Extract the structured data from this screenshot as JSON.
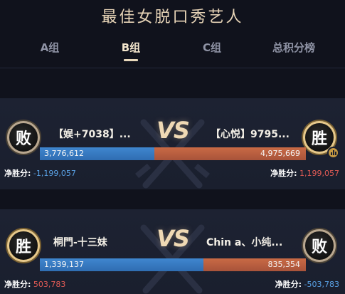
{
  "title": "最佳女脱口秀艺人",
  "tabs": [
    {
      "label": "A组",
      "active": false
    },
    {
      "label": "B组",
      "active": true
    },
    {
      "label": "C组",
      "active": false
    },
    {
      "label": "总积分榜",
      "active": false
    }
  ],
  "vs_label": "VS",
  "net_label": "净胜分:",
  "colors": {
    "left_bar": "#3f86cf",
    "right_bar": "#c96a45",
    "negative": "#5aa2e6",
    "positive": "#e15b55",
    "title": "#e6d3b6"
  },
  "matches": [
    {
      "left": {
        "badge": "败",
        "result": "lose",
        "name": "【娱+7038】...",
        "score": "3,776,612",
        "score_value": 3776612,
        "net": "-1,199,057"
      },
      "right": {
        "badge": "胜",
        "result": "win",
        "name": "【心悦】9795...",
        "score": "4,975,669",
        "score_value": 4975669,
        "net": "1,199,057",
        "rank_icon": "bar-chart-icon"
      }
    },
    {
      "left": {
        "badge": "胜",
        "result": "win",
        "name": "桐門-十三妹",
        "score": "1,339,137",
        "score_value": 1339137,
        "net": "503,783"
      },
      "right": {
        "badge": "败",
        "result": "lose",
        "name": "Chin a、小纯...",
        "score": "835,354",
        "score_value": 835354,
        "net": "-503,783"
      }
    }
  ]
}
